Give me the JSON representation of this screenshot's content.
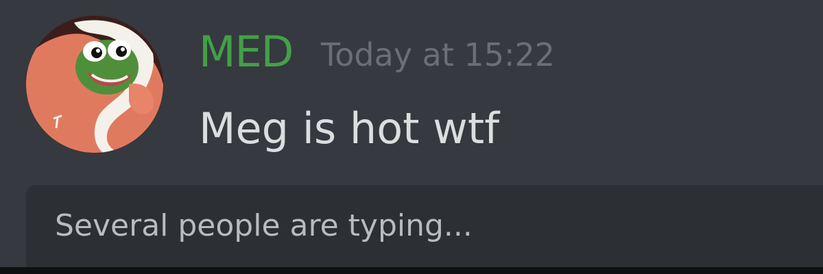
{
  "message": {
    "author": "MED",
    "timestamp": "Today at 15:22",
    "content": "Meg is hot wtf"
  },
  "typing": {
    "text": "Several people are typing..."
  },
  "colors": {
    "background": "#36393f",
    "author_name": "#43a047",
    "timestamp": "#6b6e74",
    "message_text": "#dcddde",
    "typing_bar": "#2c2f33",
    "typing_text": "#b9bbbe"
  },
  "icons": {
    "avatar": "pepe-frog-blanket-avatar"
  }
}
